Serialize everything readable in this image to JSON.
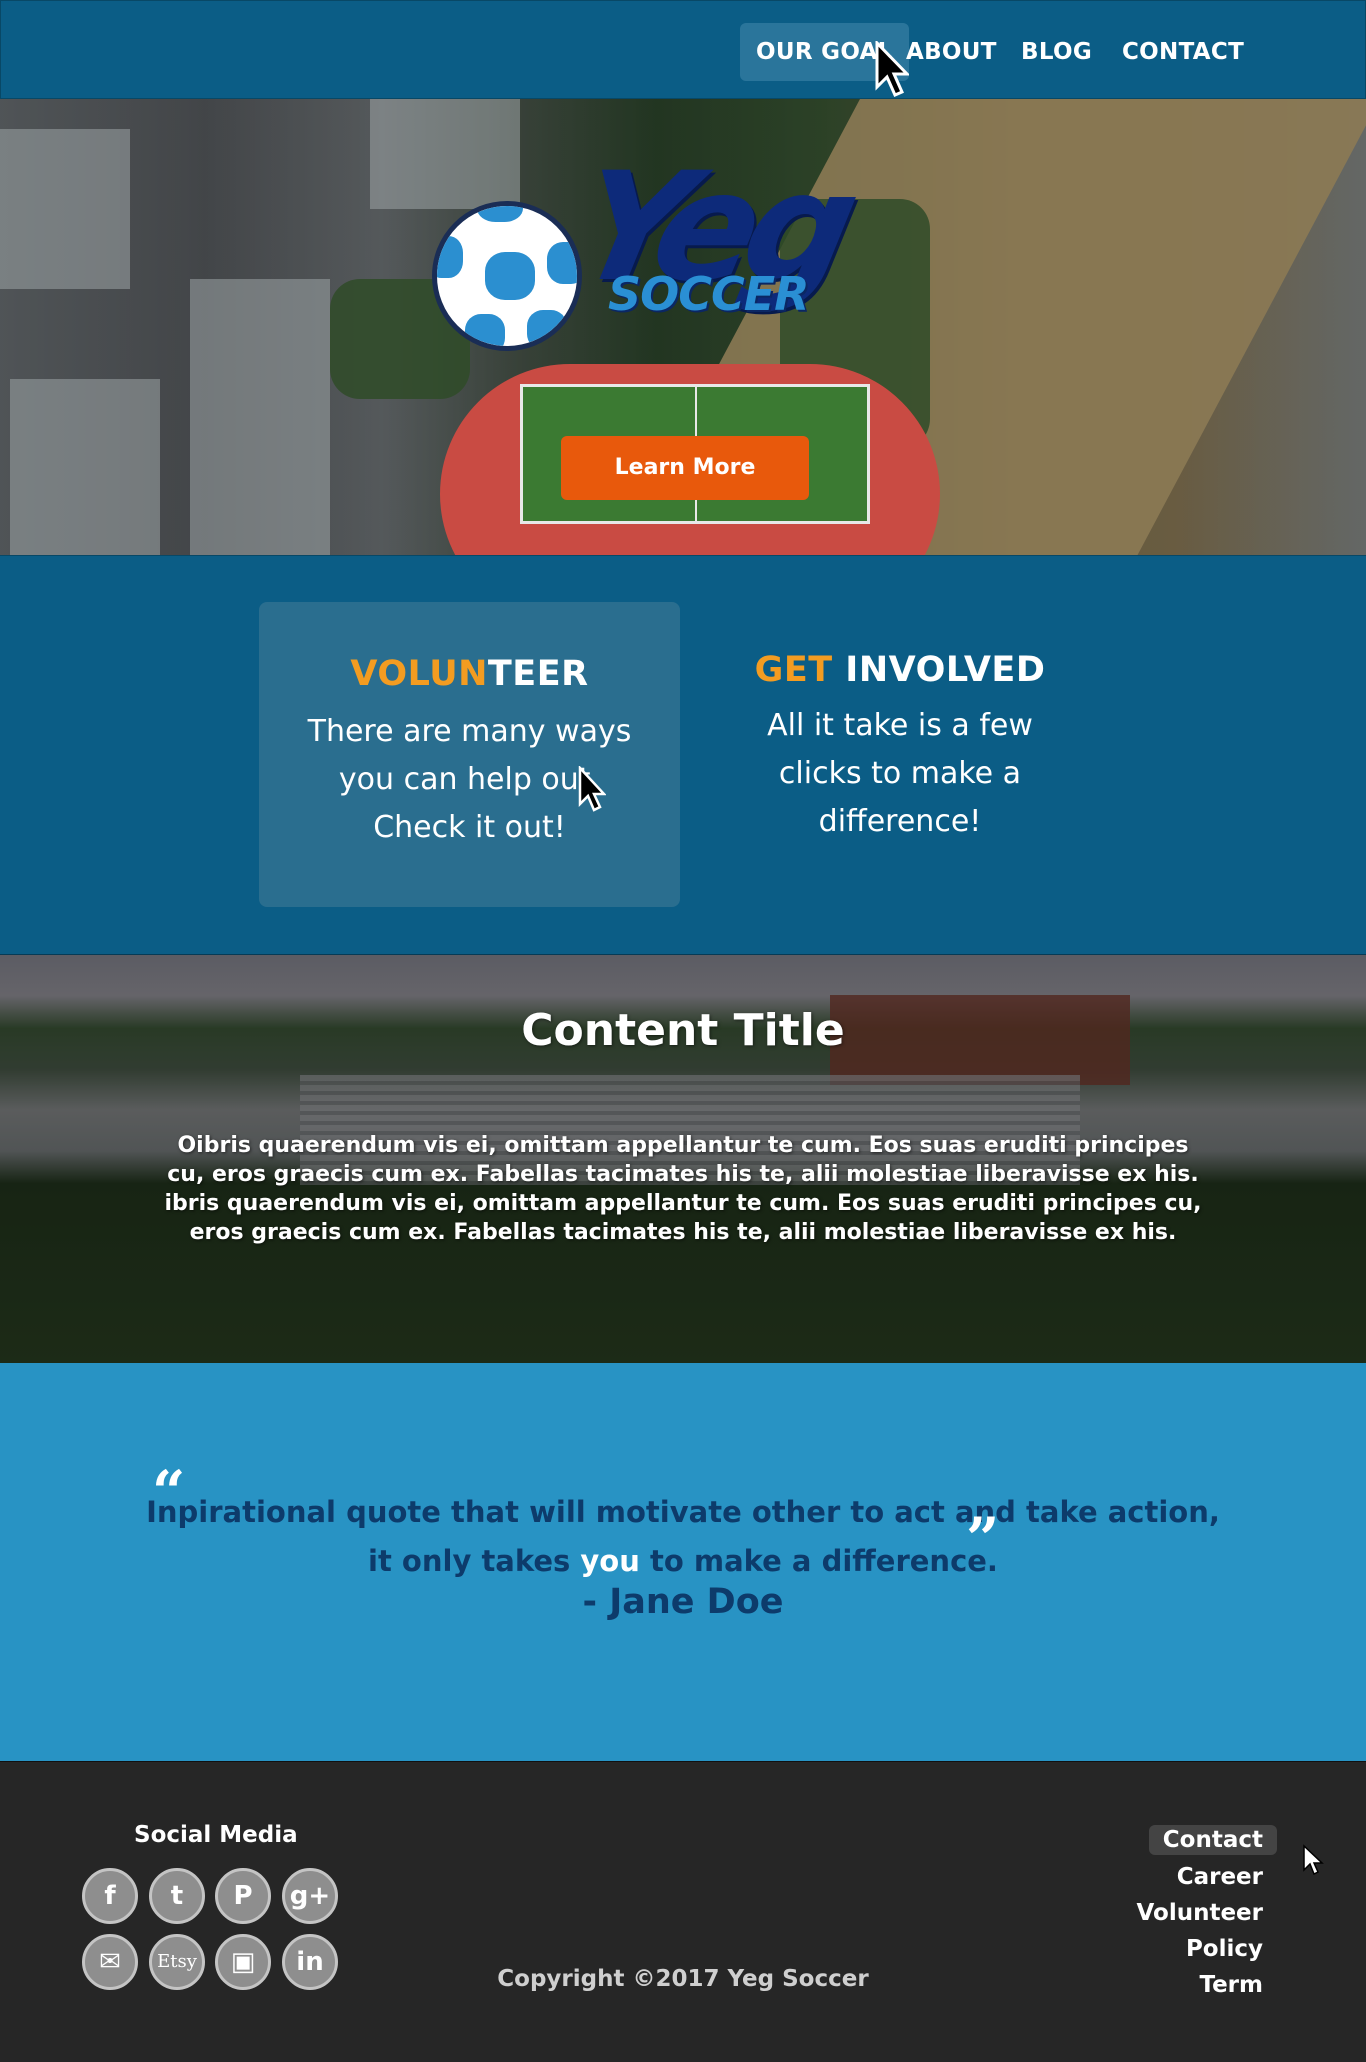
{
  "nav": {
    "items": [
      {
        "label": "OUR GOAL"
      },
      {
        "label": "ABOUT"
      },
      {
        "label": "BLOG"
      },
      {
        "label": "CONTACT"
      }
    ]
  },
  "hero": {
    "logo": {
      "main": "Yeg",
      "sub": "SOCCER"
    },
    "button_label": "Learn More"
  },
  "features": {
    "volunteer": {
      "title_highlight": "VOLUN",
      "title_rest": "TEER",
      "text_lines": [
        "There are many ways",
        "you can help out.",
        "Check it out!"
      ]
    },
    "involved": {
      "title_highlight": "GET",
      "title_rest": " INVOLVED",
      "text_lines": [
        "All it take is a few",
        "clicks to make a",
        "difference!"
      ]
    }
  },
  "content": {
    "title": "Content Title",
    "body": "Oibris quaerendum vis ei, omittam appellantur te cum. Eos suas eruditi principes cu, eros graecis cum ex. Fabellas tacimates his te, alii molestiae liberavisse ex his. ibris quaerendum vis ei, omittam appellantur te cum. Eos suas eruditi principes cu, eros graecis cum ex. Fabellas tacimates his te, alii molestiae liberavisse ex his."
  },
  "quote": {
    "line1": "Inpirational quote that will motivate other to act and take action,",
    "line2_before": "it only takes ",
    "line2_highlight": "you",
    "line2_after": " to make a difference.",
    "author": "- Jane Doe",
    "open_mark": "“",
    "close_mark": "”"
  },
  "footer": {
    "social_title": "Social Media",
    "social_icons": [
      "facebook-icon",
      "twitter-icon",
      "pinterest-icon",
      "google-plus-icon",
      "email-icon",
      "etsy-icon",
      "instagram-icon",
      "linkedin-icon"
    ],
    "social_glyphs": [
      "f",
      "t",
      "P",
      "g+",
      "✉",
      "Etsy",
      "▣",
      "in"
    ],
    "copyright": "Copyright ©2017 Yeg Soccer",
    "links": [
      "Contact",
      "Career",
      "Volunteer",
      "Policy",
      "Term"
    ]
  },
  "colors": {
    "nav_bg": "#0b5d86",
    "accent_orange": "#f39c21",
    "button_orange": "#e8590c",
    "quote_bg": "#2893c4",
    "quote_text": "#0d3b6b",
    "footer_bg": "#262626"
  }
}
